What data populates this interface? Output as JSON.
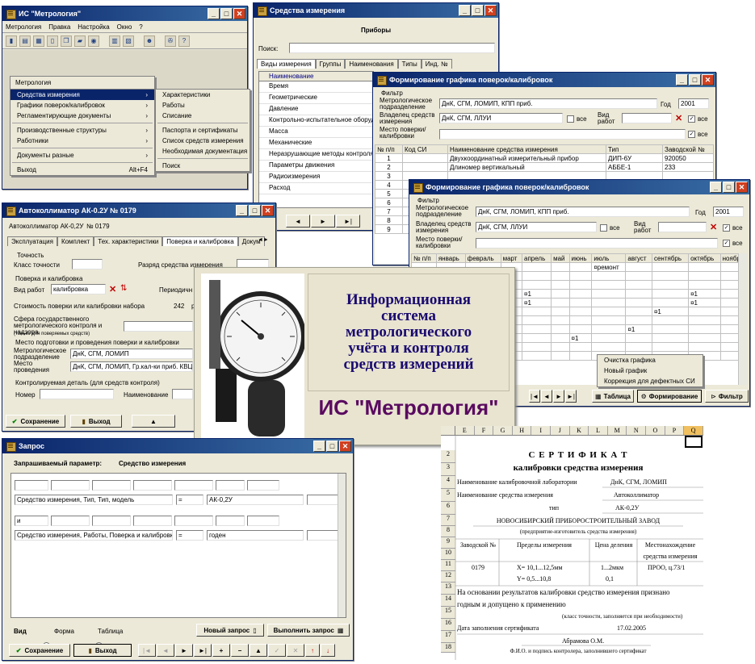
{
  "main_window": {
    "title": "ИС \"Метрология\"",
    "menu": [
      "Метрология",
      "Правка",
      "Настройка",
      "Окно",
      "?"
    ],
    "menu_open": "Метрология",
    "menu_items": [
      "Средства измерения",
      "Графики поверок/калибровок",
      "Регламентирующие документы",
      "Производственные структуры",
      "Работники",
      "Документы разные",
      "Выход"
    ],
    "exit_shortcut": "Alt+F4",
    "submenu_items": [
      "Характеристики",
      "Работы",
      "Списание",
      "Паспорта и сертификаты",
      "Список средств измерения",
      "Необходимая документация",
      "Поиск"
    ]
  },
  "instruments_window": {
    "title": "Средства измерения",
    "header": "Приборы",
    "search_label": "Поиск:",
    "tabs": [
      "Виды измерения",
      "Группы",
      "Наименования",
      "Типы",
      "Инд. №"
    ],
    "column": "Наименование",
    "rows": [
      "Время",
      "Геометрические",
      "Давление",
      "Контрольно-испытательное оборуд",
      "Масса",
      "Механические",
      "Неразрушающие методы контроля",
      "Параметры движения",
      "Радиоизмерения",
      "Расход"
    ]
  },
  "schedule1": {
    "title": "Формирование графика поверок/калибровок",
    "filter_label": "Фильтр",
    "metro_label": "Метрологическое подразделение",
    "metro_value": "ДнК, СГМ, ЛОМИП, КПП приб.",
    "year_label": "Год",
    "year_value": "2001",
    "owner_label": "Владелец средств измерения",
    "owner_value": "ДнК, СГМ, ЛЛУИ",
    "all_label": "все",
    "work_label": "Вид работ",
    "place_label": "Место поверки/ калибровки",
    "columns": [
      "№ п/п",
      "Код СИ",
      "Наименование средства измерения",
      "Тип",
      "Заводской №"
    ],
    "rows": [
      {
        "n": "1",
        "code": "",
        "name": "Двухкоординатный измерительный прибор",
        "type": "ДИП-6У",
        "factory": "920050"
      },
      {
        "n": "2",
        "code": "",
        "name": "Длиномер вертикальный",
        "type": "АББЕ-1",
        "factory": "233"
      },
      {
        "n": "3",
        "code": "",
        "name": "",
        "type": "",
        "factory": ""
      },
      {
        "n": "4",
        "code": "",
        "name": "",
        "type": "",
        "factory": ""
      },
      {
        "n": "5",
        "code": "",
        "name": "",
        "type": "",
        "factory": ""
      },
      {
        "n": "6",
        "code": "",
        "name": "",
        "type": "",
        "factory": ""
      },
      {
        "n": "7",
        "code": "",
        "name": "",
        "type": "",
        "factory": ""
      },
      {
        "n": "8",
        "code": "",
        "name": "",
        "type": "",
        "factory": ""
      },
      {
        "n": "9",
        "code": "",
        "name": "",
        "type": "",
        "factory": ""
      }
    ]
  },
  "schedule2": {
    "title": "Формирование графика поверок/калибровок",
    "filter_label": "Фильтр",
    "metro_label": "Метрологическое подразделение",
    "metro_value": "ДнК, СГМ, ЛОМИП, КПП приб.",
    "year_label": "Год",
    "year_value": "2001",
    "owner_label": "Владелец средств измерения",
    "owner_value": "ДнК, СГМ, ЛЛУИ",
    "all_label": "все",
    "work_label": "Вид работ",
    "place_label": "Место поверки/ калибровки",
    "columns": [
      "№ п/п",
      "январь",
      "февраль",
      "март",
      "апрель",
      "май",
      "июнь",
      "июль",
      "август",
      "сентябрь",
      "октябрь",
      "ноябрь"
    ],
    "remont": "ремонт",
    "mark": "1",
    "context_menu": [
      "Очистка графика",
      "Новый график",
      "Коррекция для дефектных СИ"
    ],
    "bottom_buttons": [
      "Таблица",
      "Формирование",
      "Фильтр"
    ]
  },
  "autocoll": {
    "title": "Автоколлиматор АК-0.2У № 0179",
    "subtitle_type": "Автоколлиматор АК-0,2У",
    "subtitle_num": "№ 0179",
    "tabs": [
      "Эксплуатация",
      "Комплект",
      "Тех. характеристики",
      "Поверка и калибровка",
      "Докум"
    ],
    "accuracy_group": "Точность",
    "accuracy_class": "Класс точности",
    "category": "Разряд средства измерения",
    "verif_group": "Поверка и калибровка",
    "work_type": "Вид работ",
    "work_value": "калибровка",
    "periodicity": "Периодичн",
    "cost_label": "Стоимость поверки или калибровки набора",
    "cost_value": "242",
    "cost_unit": "р",
    "state_sphere": "Сфера государственного метрологического контроля и надзора",
    "state_note": "(только для поверяемых средств)",
    "place_group": "Место подготовки и проведения поверки и калибровки",
    "metro_label": "Метрологическое подразделение",
    "metro_value": "ДнК, СГМ, ЛОМИП",
    "place_label": "Место проведения",
    "place_value": "ДнК, СГМ, ЛОМИП, Гр.кал-ки приб. КВЦ",
    "control_group": "Контролируемая деталь (для средств контроля)",
    "number_label": "Номер",
    "name_label": "Наименование",
    "save": "Сохранение",
    "exit": "Выход"
  },
  "splash": {
    "title_lines": [
      "Информационная",
      "система",
      "метрологического",
      "учёта и контроля",
      "средств измерений"
    ],
    "brand": "ИС \"Метрология\""
  },
  "query": {
    "title": "Запрос",
    "param_label": "Запрашиваемый параметр:",
    "param_value": "Средство измерения",
    "row1_field": "Средство измерения, Тип, Тип, модель",
    "row1_op": "=",
    "row1_value": "АК-0,2У",
    "connector": "и",
    "row2_field": "Средство измерения, Работы, Поверка и калибровка",
    "row2_op": "=",
    "row2_value": "годен",
    "view_label": "Вид",
    "view_form": "Форма",
    "view_table": "Таблица",
    "new_query": "Новый запрос",
    "run_query": "Выполнить запрос",
    "save": "Сохранение",
    "exit": "Выход"
  },
  "certificate": {
    "col_headers": [
      "E",
      "F",
      "G",
      "H",
      "I",
      "J",
      "K",
      "L",
      "M",
      "N",
      "O",
      "P",
      "Q"
    ],
    "row_numbers": [
      "2",
      "3",
      "4",
      "5",
      "6",
      "7",
      "8",
      "9",
      "10",
      "11",
      "12",
      "13",
      "14",
      "15",
      "16",
      "17",
      "18"
    ],
    "title": "С Е Р Т И Ф И К А Т",
    "subtitle": "калибровки средства измерения",
    "lab_label": "Наименование калибровочной лаборатории",
    "lab_value": "ДнК, СГМ, ЛОМИП",
    "si_label": "Наименование средства измерения",
    "si_value": "Автоколлиматор",
    "type_label": "тип",
    "type_value": "АК-0,2У",
    "maker": "НОВОСИБИРСКИЙ ПРИБОРОСТРОИТЕЛЬНЫЙ ЗАВОД",
    "maker_note": "(предприятие-изготовитель средства измерения)",
    "h_factory": "Заводской №",
    "h_limits": "Пределы измерения",
    "h_price": "Цена деления",
    "h_location": "Местонахождение средства измерения",
    "v_factory": "0179",
    "v_limits1": "X= 10,1...12,5мм",
    "v_limits2": "Y= 0,5...10,8",
    "v_price1": "1...2мкм",
    "v_price2": "0,1",
    "v_location": "ПРОО, ц.73/1",
    "conclusion1": "На основании результатов калибровки средство измерения признано",
    "conclusion2": "годным и допущено к применению",
    "class_note": "(класс точности, заполняется при необходимости)",
    "date_label": "Дата заполнения сертификата",
    "date_value": "17.02.2005",
    "signer": "Абрамова О.М.",
    "signer_note": "Ф.И.О. и подпись контролера, заполнившего сертификат"
  }
}
